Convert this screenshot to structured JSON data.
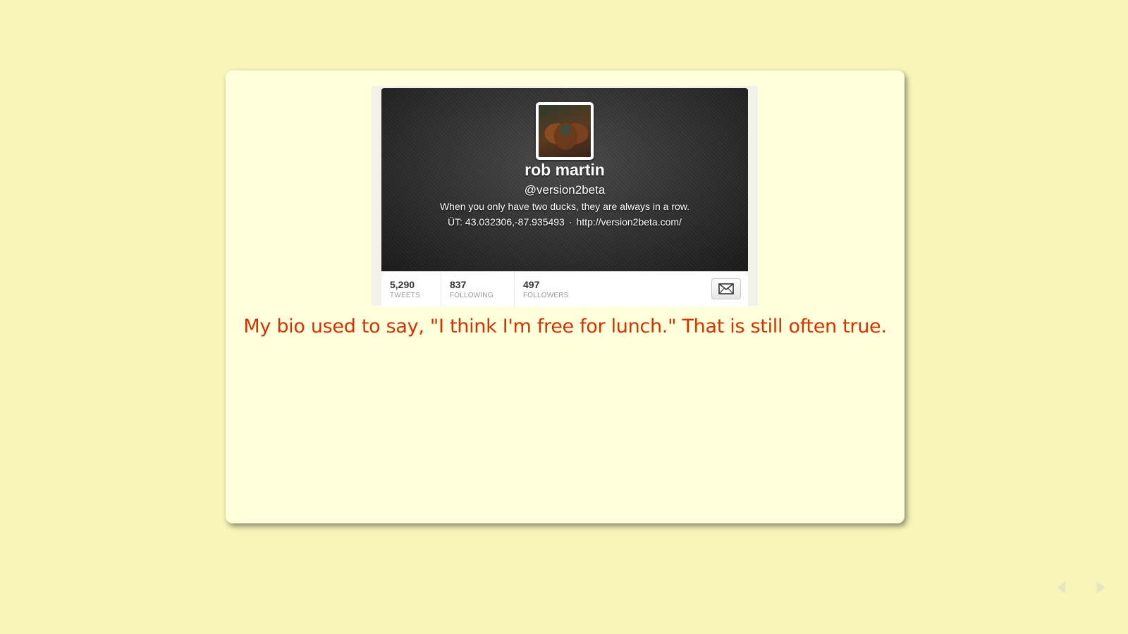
{
  "profile": {
    "name": "rob martin",
    "handle": "@version2beta",
    "bio": "When you only have two ducks, they are always in a row.",
    "location": "ÜT: 43.032306,-87.935493",
    "separator": "·",
    "url": "http://version2beta.com/"
  },
  "stats": {
    "tweets": {
      "value": "5,290",
      "label": "TWEETS"
    },
    "following": {
      "value": "837",
      "label": "FOLLOWING"
    },
    "followers": {
      "value": "497",
      "label": "FOLLOWERS"
    }
  },
  "caption": "My bio used to say, \"I think I'm free for lunch.\" That is still often true.",
  "icons": {
    "message": "envelope-icon",
    "prev": "arrow-left-icon",
    "next": "arrow-right-icon"
  },
  "colors": {
    "background": "#f7f5b8",
    "slide": "#ffffdc",
    "caption": "#d33300"
  }
}
